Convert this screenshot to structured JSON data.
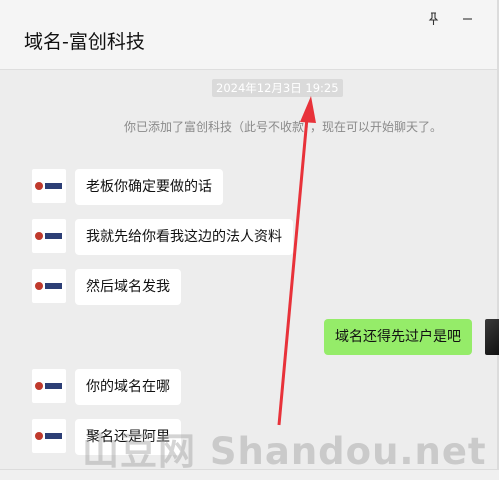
{
  "window": {
    "title": "域名-富创科技"
  },
  "colors": {
    "my_bubble": "#95ec69",
    "annotation_arrow": "#e8323a"
  },
  "chat": {
    "timestamp": "2024年12月3日 19:25",
    "system_message": "你已添加了富创科技（此号不收款），现在可以开始聊天了。",
    "messages": [
      {
        "side": "left",
        "text": "老板你确定要做的话"
      },
      {
        "side": "left",
        "text": "我就先给你看我这边的法人资料"
      },
      {
        "side": "left",
        "text": "然后域名发我"
      },
      {
        "side": "right",
        "text": "域名还得先过户是吧"
      },
      {
        "side": "left",
        "text": "你的域名在哪"
      },
      {
        "side": "left",
        "text": "聚名还是阿里"
      }
    ]
  },
  "watermark": {
    "text": "山豆网 Shandou.net"
  }
}
